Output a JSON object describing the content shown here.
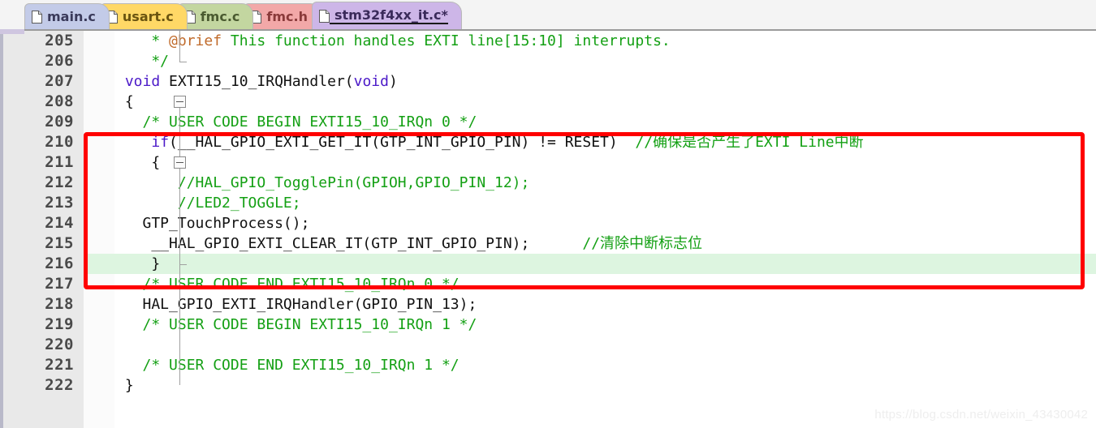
{
  "tabs": [
    {
      "label": "main.c",
      "bg": "#c3cbe8",
      "fg": "#3a3a5a",
      "active": false,
      "icon": "file-icon"
    },
    {
      "label": "usart.c",
      "bg": "#ffd866",
      "fg": "#6a5410",
      "active": false,
      "icon": "file-icon"
    },
    {
      "label": "fmc.c",
      "bg": "#c3d6a0",
      "fg": "#4a5a30",
      "active": false,
      "icon": "file-icon"
    },
    {
      "label": "fmc.h",
      "bg": "#f2a8a8",
      "fg": "#8a3a3a",
      "active": false,
      "icon": "file-icon"
    },
    {
      "label": "stm32f4xx_it.c*",
      "bg": "#cdb6e8",
      "fg": "#3a2a5a",
      "active": true,
      "icon": "file-icon"
    }
  ],
  "editor": {
    "first_line": 205,
    "highlight_line": 216,
    "fold_markers": [
      208,
      211
    ],
    "fold_ends": [
      206,
      216
    ],
    "lines": [
      {
        "no": 205,
        "segments": [
          {
            "t": "    * ",
            "c": "c-com"
          },
          {
            "t": "@brief",
            "c": "c-brief"
          },
          {
            "t": " This function handles EXTI line[15:10] interrupts.",
            "c": "c-com"
          }
        ]
      },
      {
        "no": 206,
        "segments": [
          {
            "t": "    */",
            "c": "c-com"
          }
        ]
      },
      {
        "no": 207,
        "segments": [
          {
            "t": " ",
            "c": "c-plain"
          },
          {
            "t": "void",
            "c": "c-kw"
          },
          {
            "t": " EXTI15_10_IRQHandler(",
            "c": "c-plain"
          },
          {
            "t": "void",
            "c": "c-kw"
          },
          {
            "t": ")",
            "c": "c-plain"
          }
        ]
      },
      {
        "no": 208,
        "segments": [
          {
            "t": " {",
            "c": "c-plain"
          }
        ]
      },
      {
        "no": 209,
        "segments": [
          {
            "t": "   /* USER CODE BEGIN EXTI15_10_IRQn 0 */",
            "c": "c-com"
          }
        ]
      },
      {
        "no": 210,
        "segments": [
          {
            "t": "    ",
            "c": "c-plain"
          },
          {
            "t": "if",
            "c": "c-kw"
          },
          {
            "t": "(__HAL_GPIO_EXTI_GET_IT(GTP_INT_GPIO_PIN) != RESET)  ",
            "c": "c-plain"
          },
          {
            "t": "//确保是否产生了EXTI Line中断",
            "c": "c-com"
          }
        ]
      },
      {
        "no": 211,
        "segments": [
          {
            "t": "    {",
            "c": "c-plain"
          }
        ]
      },
      {
        "no": 212,
        "segments": [
          {
            "t": "       //HAL_GPIO_TogglePin(GPIOH,GPIO_PIN_12);",
            "c": "c-com"
          }
        ]
      },
      {
        "no": 213,
        "segments": [
          {
            "t": "       //LED2_TOGGLE;",
            "c": "c-com"
          }
        ]
      },
      {
        "no": 214,
        "segments": [
          {
            "t": "   GTP_TouchProcess();",
            "c": "c-plain"
          }
        ]
      },
      {
        "no": 215,
        "segments": [
          {
            "t": "    __HAL_GPIO_EXTI_CLEAR_IT(GTP_INT_GPIO_PIN);      ",
            "c": "c-plain"
          },
          {
            "t": "//清除中断标志位",
            "c": "c-com"
          }
        ]
      },
      {
        "no": 216,
        "segments": [
          {
            "t": "    }",
            "c": "c-plain"
          }
        ]
      },
      {
        "no": 217,
        "segments": [
          {
            "t": "   /* USER CODE END EXTI15_10_IRQn 0 */",
            "c": "c-com"
          }
        ]
      },
      {
        "no": 218,
        "segments": [
          {
            "t": "   HAL_GPIO_EXTI_IRQHandler(GPIO_PIN_13);",
            "c": "c-plain"
          }
        ]
      },
      {
        "no": 219,
        "segments": [
          {
            "t": "   /* USER CODE BEGIN EXTI15_10_IRQn 1 */",
            "c": "c-com"
          }
        ]
      },
      {
        "no": 220,
        "segments": [
          {
            "t": "",
            "c": "c-plain"
          }
        ]
      },
      {
        "no": 221,
        "segments": [
          {
            "t": "   /* USER CODE END EXTI15_10_IRQn 1 */",
            "c": "c-com"
          }
        ]
      },
      {
        "no": 222,
        "segments": [
          {
            "t": " }",
            "c": "c-plain"
          }
        ]
      }
    ]
  },
  "annotation": {
    "color": "#ff0000",
    "shape": "rectangle",
    "covers_lines": "210-216"
  },
  "watermark": {
    "text": "https://blog.csdn.net/weixin_43430042"
  },
  "colors": {
    "highlight_line_bg": "#ddf5e0",
    "comment": "#14a014",
    "keyword": "#4b19c8",
    "brief_tag": "#c06a2a",
    "gutter_bg": "#e9e9e9"
  }
}
